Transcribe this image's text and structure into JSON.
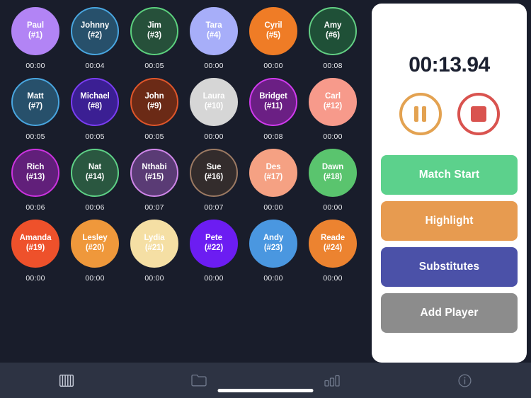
{
  "app": {
    "background_color": "#191d2b",
    "panel_color": "#ffffff",
    "tabbar_color": "#2d3343"
  },
  "players": [
    {
      "name": "Paul",
      "number": "(#1)",
      "time": "00:00",
      "fill": "#b284f5",
      "ring": "#b284f5"
    },
    {
      "name": "Johnny",
      "number": "(#2)",
      "time": "00:04",
      "fill": "#27506b",
      "ring": "#49a6e0"
    },
    {
      "name": "Jim",
      "number": "(#3)",
      "time": "00:05",
      "fill": "#26503a",
      "ring": "#5cd17e"
    },
    {
      "name": "Tara",
      "number": "(#4)",
      "time": "00:00",
      "fill": "#a7aef9",
      "ring": "#a7aef9"
    },
    {
      "name": "Cyril",
      "number": "(#5)",
      "time": "00:00",
      "fill": "#ef7c26",
      "ring": "#ef7c26"
    },
    {
      "name": "Amy",
      "number": "(#6)",
      "time": "00:08",
      "fill": "#1f5037",
      "ring": "#63cf84"
    },
    {
      "name": "Matt",
      "number": "(#7)",
      "time": "00:05",
      "fill": "#27506b",
      "ring": "#49a6e0"
    },
    {
      "name": "Michael",
      "number": "(#8)",
      "time": "00:05",
      "fill": "#3b1f93",
      "ring": "#7a3df2"
    },
    {
      "name": "John",
      "number": "(#9)",
      "time": "00:05",
      "fill": "#6b2a16",
      "ring": "#e0562a"
    },
    {
      "name": "Laura",
      "number": "(#10)",
      "time": "00:00",
      "fill": "#d6d6d6",
      "ring": "#d6d6d6"
    },
    {
      "name": "Bridget",
      "number": "(#11)",
      "time": "00:08",
      "fill": "#6b1f84",
      "ring": "#d13bef"
    },
    {
      "name": "Carl",
      "number": "(#12)",
      "time": "00:00",
      "fill": "#f79a8b",
      "ring": "#f79a8b"
    },
    {
      "name": "Rich",
      "number": "(#13)",
      "time": "00:06",
      "fill": "#611f7a",
      "ring": "#cc33e0"
    },
    {
      "name": "Nat",
      "number": "(#14)",
      "time": "00:06",
      "fill": "#2a5740",
      "ring": "#5ed186"
    },
    {
      "name": "Nthabi",
      "number": "(#15)",
      "time": "00:07",
      "fill": "#5a3b75",
      "ring": "#d087ea"
    },
    {
      "name": "Sue",
      "number": "(#16)",
      "time": "00:07",
      "fill": "#332c2c",
      "ring": "#9c7a63"
    },
    {
      "name": "Des",
      "number": "(#17)",
      "time": "00:00",
      "fill": "#f5a183",
      "ring": "#f5a183"
    },
    {
      "name": "Dawn",
      "number": "(#18)",
      "time": "00:00",
      "fill": "#5ac46e",
      "ring": "#5ac46e"
    },
    {
      "name": "Amanda",
      "number": "(#19)",
      "time": "00:00",
      "fill": "#ee512b",
      "ring": "#ee512b"
    },
    {
      "name": "Lesley",
      "number": "(#20)",
      "time": "00:00",
      "fill": "#ef983b",
      "ring": "#ef983b"
    },
    {
      "name": "Lydia",
      "number": "(#21)",
      "time": "00:00",
      "fill": "#f5dfa4",
      "ring": "#f5dfa4"
    },
    {
      "name": "Pete",
      "number": "(#22)",
      "time": "00:00",
      "fill": "#6c1df2",
      "ring": "#6c1df2"
    },
    {
      "name": "Andy",
      "number": "(#23)",
      "time": "00:00",
      "fill": "#4a97e0",
      "ring": "#4a97e0"
    },
    {
      "name": "Reade",
      "number": "(#24)",
      "time": "00:00",
      "fill": "#ec8330",
      "ring": "#ec8330"
    }
  ],
  "control_panel": {
    "timer": "00:13.94",
    "pause_icon": "pause-icon",
    "stop_icon": "stop-icon",
    "pause_color": "#e3a251",
    "stop_color": "#d9534f",
    "buttons": [
      {
        "label": "Match Start",
        "color": "#5cd18c",
        "name": "match-start-button"
      },
      {
        "label": "Highlight",
        "color": "#e79b50",
        "name": "highlight-button"
      },
      {
        "label": "Substitutes",
        "color": "#4b51a8",
        "name": "substitutes-button"
      },
      {
        "label": "Add Player",
        "color": "#8c8c8c",
        "name": "add-player-button"
      }
    ]
  },
  "tab_bar": {
    "items": [
      {
        "icon": "squad-grid-icon",
        "name": "tab-squad"
      },
      {
        "icon": "folder-icon",
        "name": "tab-files"
      },
      {
        "icon": "bar-chart-icon",
        "name": "tab-stats"
      },
      {
        "icon": "info-circle-icon",
        "name": "tab-info"
      }
    ]
  }
}
